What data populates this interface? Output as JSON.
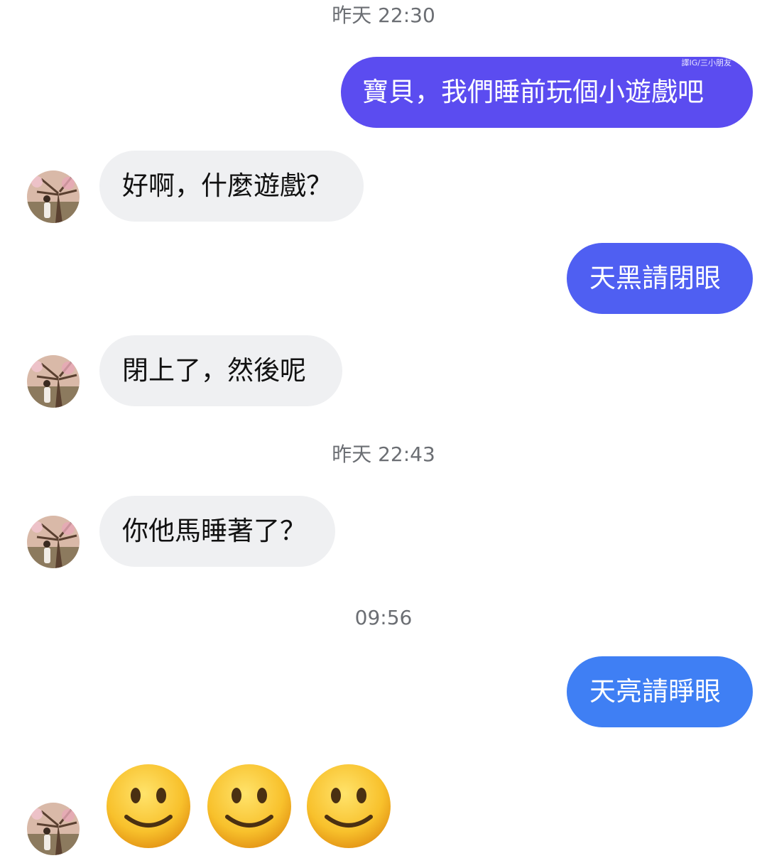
{
  "timestamps": [
    "昨天 22:30",
    "昨天 22:43",
    "09:56"
  ],
  "messages": [
    {
      "text": "寶貝，我們睡前玩個小遊戲吧",
      "from": "me",
      "color": "#5b4cf0"
    },
    {
      "text": "好啊，什麼遊戲？",
      "from": "them"
    },
    {
      "text": "天黑請閉眼",
      "from": "me",
      "color": "#4f5ff2"
    },
    {
      "text": "閉上了，然後呢",
      "from": "them"
    },
    {
      "text": "你他馬睡著了？",
      "from": "them"
    },
    {
      "text": "天亮請睜眼",
      "from": "me",
      "color": "#3f7ff4"
    }
  ],
  "watermark": "譯IG/三小朋友",
  "emoji_reaction": {
    "icon": "slightly-smiling-face-icon",
    "count": 3
  }
}
